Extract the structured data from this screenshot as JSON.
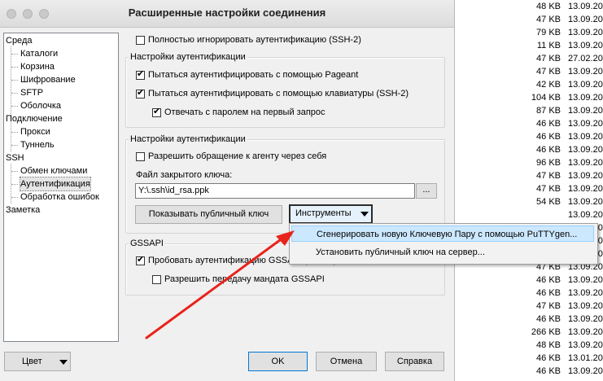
{
  "window": {
    "title": "Расширенные настройки соединения"
  },
  "tree": {
    "items": [
      {
        "label": "Среда",
        "level": 0
      },
      {
        "label": "Каталоги",
        "level": 1
      },
      {
        "label": "Корзина",
        "level": 1
      },
      {
        "label": "Шифрование",
        "level": 1
      },
      {
        "label": "SFTP",
        "level": 1
      },
      {
        "label": "Оболочка",
        "level": 1
      },
      {
        "label": "Подключение",
        "level": 0
      },
      {
        "label": "Прокси",
        "level": 1
      },
      {
        "label": "Туннель",
        "level": 1
      },
      {
        "label": "SSH",
        "level": 0
      },
      {
        "label": "Обмен ключами",
        "level": 1
      },
      {
        "label": "Аутентификация",
        "level": 1,
        "selected": true
      },
      {
        "label": "Обработка ошибок",
        "level": 1
      },
      {
        "label": "Заметка",
        "level": 0
      }
    ]
  },
  "auth": {
    "ignore_auth": {
      "label": "Полностью игнорировать аутентификацию (SSH-2)",
      "checked": false
    },
    "group1_title": "Настройки аутентификации",
    "pageant": {
      "label": "Пытаться аутентифицировать с помощью Pageant",
      "checked": true
    },
    "keyboard": {
      "label": "Пытаться аутентифицировать с помощью клавиатуры (SSH-2)",
      "checked": true
    },
    "respond_password": {
      "label": "Отвечать с паролем на первый запрос",
      "checked": true
    },
    "group2_title": "Настройки аутентификации",
    "agent_forwarding": {
      "label": "Разрешить обращение к агенту через себя",
      "checked": false
    },
    "private_key_label": "Файл закрытого ключа:",
    "private_key_value": "Y:\\.ssh\\id_rsa.ppk",
    "browse_label": "...",
    "show_public_key": "Показывать публичный ключ",
    "tools_label": "Инструменты",
    "gssapi_title": "GSSAPI",
    "gssapi_try": {
      "label": "Пробовать аутентификацию GSSAPI (SSH-2)",
      "checked": true
    },
    "gssapi_delegate": {
      "label": "Разрешить передачу мандата GSSAPI",
      "checked": false
    }
  },
  "menu": {
    "items": [
      {
        "label": "Сгенерировать новую Ключевую Пару с помощью PuTTYgen...",
        "highlighted": true
      },
      {
        "label": "Установить публичный ключ на сервер...",
        "highlighted": false
      }
    ]
  },
  "footer": {
    "color": "Цвет",
    "ok": "OK",
    "cancel": "Отмена",
    "help": "Справка"
  },
  "background_files": [
    {
      "size": "48 KB",
      "date": "13.09.20"
    },
    {
      "size": "47 KB",
      "date": "13.09.20"
    },
    {
      "size": "79 KB",
      "date": "13.09.20"
    },
    {
      "size": "11 KB",
      "date": "13.09.20"
    },
    {
      "size": "47 KB",
      "date": "27.02.20"
    },
    {
      "size": "47 KB",
      "date": "13.09.20"
    },
    {
      "size": "42 KB",
      "date": "13.09.20"
    },
    {
      "size": "104 KB",
      "date": "13.09.20"
    },
    {
      "size": "87 KB",
      "date": "13.09.20"
    },
    {
      "size": "46 KB",
      "date": "13.09.20"
    },
    {
      "size": "46 KB",
      "date": "13.09.20"
    },
    {
      "size": "46 KB",
      "date": "13.09.20"
    },
    {
      "size": "96 KB",
      "date": "13.09.20"
    },
    {
      "size": "47 KB",
      "date": "13.09.20"
    },
    {
      "size": "47 KB",
      "date": "13.09.20"
    },
    {
      "size": "54 KB",
      "date": "13.09.20"
    },
    {
      "size": "",
      "date": "13.09.20"
    },
    {
      "size": "",
      "date": "13.09.20"
    },
    {
      "size": "",
      "date": "13.09.20"
    },
    {
      "size": "",
      "date": "13.09.20"
    },
    {
      "size": "47 KB",
      "date": "13.09.20"
    },
    {
      "size": "46 KB",
      "date": "13.09.20"
    },
    {
      "size": "46 KB",
      "date": "13.09.20"
    },
    {
      "size": "47 KB",
      "date": "13.09.20"
    },
    {
      "size": "46 KB",
      "date": "13.09.20"
    },
    {
      "size": "266 KB",
      "date": "13.09.20"
    },
    {
      "size": "48 KB",
      "date": "13.09.20"
    },
    {
      "size": "46 KB",
      "date": "13.01.20"
    },
    {
      "size": "46 KB",
      "date": "13.09.20"
    }
  ]
}
